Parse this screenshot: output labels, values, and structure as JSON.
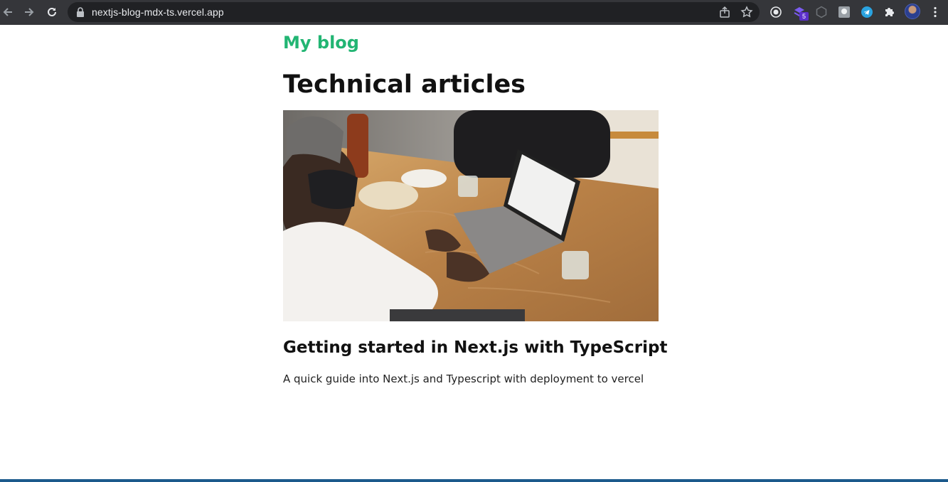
{
  "browser": {
    "url": "nextjs-blog-mdx-ts.vercel.app",
    "extension_badge": "5",
    "icons": [
      "back-icon",
      "forward-icon",
      "reload-icon",
      "lock-icon",
      "share-icon",
      "star-icon",
      "circle-target-extension-icon",
      "stacked-extension-icon",
      "hexagon-extension-icon",
      "square-extension-icon",
      "telegram-icon",
      "puzzle-extension-icon",
      "avatar",
      "kebab-menu-icon"
    ]
  },
  "site": {
    "title": "My blog",
    "accent_color": "#22b573"
  },
  "main": {
    "heading": "Technical articles",
    "posts": [
      {
        "title": "Getting started in Next.js with TypeScript",
        "description": "A quick guide into Next.js and Typescript with deployment to vercel"
      }
    ]
  }
}
